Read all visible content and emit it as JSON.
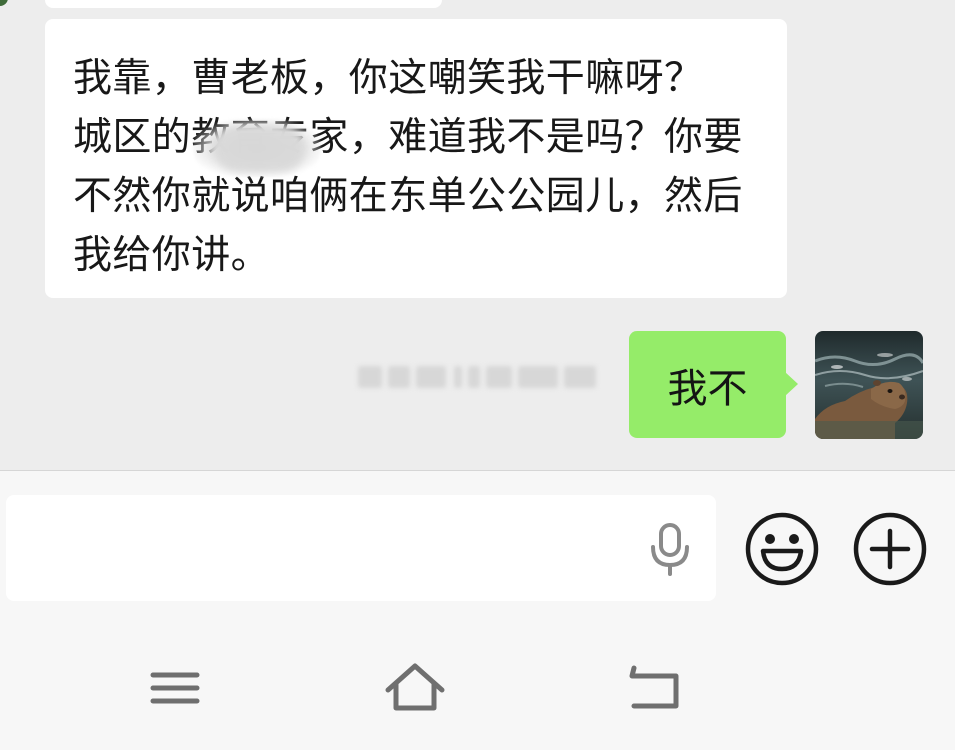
{
  "chat": {
    "incoming_message": "我靠，曹老板，你这嘲笑我干嘛呀？        城区的教育专家，难道我不是吗？你要不然你就说咱俩在东单公公园儿，然后我给你讲。",
    "outgoing_message": "我不"
  },
  "input_bar": {
    "text_value": "",
    "icons": {
      "voice": "microphone-icon",
      "emoji": "smiley-face-icon",
      "more": "plus-circle-icon"
    }
  },
  "system_nav": {
    "icons": [
      "menu-icon",
      "home-icon",
      "back-icon"
    ]
  },
  "colors": {
    "chat_background": "#ededed",
    "incoming_bubble": "#ffffff",
    "outgoing_bubble": "#95ec69",
    "input_bar_background": "#f7f7f7",
    "icon_dark": "#1a1a1a",
    "icon_gray": "#8a8a8a"
  }
}
